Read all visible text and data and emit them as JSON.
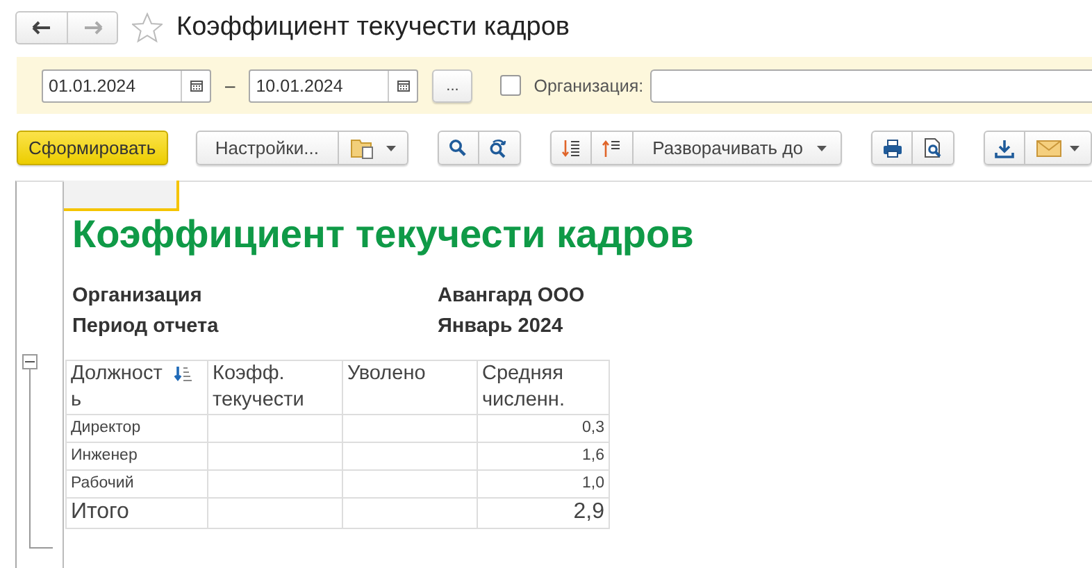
{
  "window": {
    "title": "Коэффициент текучести кадров",
    "favorite": false
  },
  "filter": {
    "date_from": "01.01.2024",
    "separator": "–",
    "date_to": "10.01.2024",
    "more_button": "...",
    "organization_checked": false,
    "organization_label": "Организация:"
  },
  "toolbar": {
    "generate_button": "Сформировать",
    "settings_button": "Настройки...",
    "expand_button": "Разворачивать до"
  },
  "report": {
    "title": "Коэффициент текучести кадров",
    "params": [
      {
        "label": "Организация",
        "value": "Авангард ООО"
      },
      {
        "label": "Период отчета",
        "value": "Январь 2024"
      }
    ],
    "table": {
      "columns": [
        "Должность",
        "Коэфф. текучести",
        "Уволено",
        "Средняя численн."
      ],
      "rows": [
        {
          "position": "Директор",
          "average": "0,3"
        },
        {
          "position": "Инженер",
          "average": "1,6"
        },
        {
          "position": "Рабочий",
          "average": "1,0"
        }
      ],
      "total": {
        "label": "Итого",
        "average": "2,9"
      }
    }
  }
}
